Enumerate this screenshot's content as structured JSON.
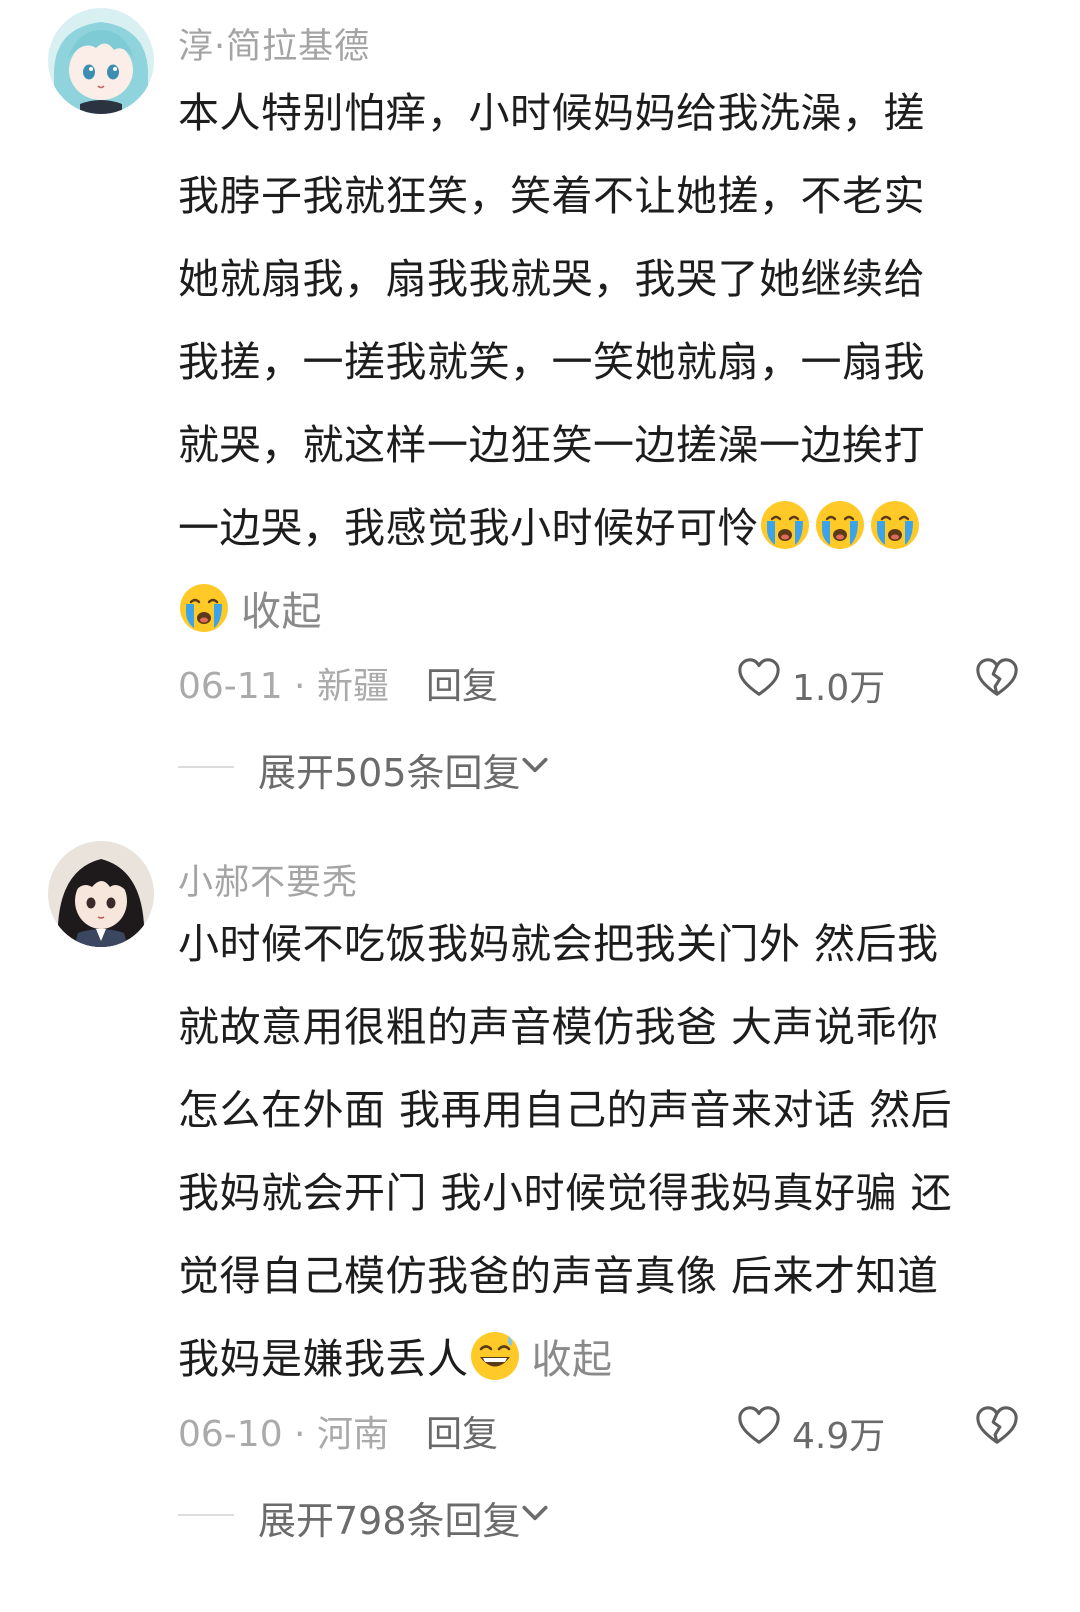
{
  "comments": [
    {
      "username": "淳·简拉基德",
      "lines": [
        "本人特别怕痒，小时候妈妈给我洗澡，搓",
        "我脖子我就狂笑，笑着不让她搓，不老实",
        "她就扇我，扇我我就哭，我哭了她继续给",
        "我搓，一搓我就笑，一笑她就扇，一扇我",
        "就哭，就这样一边狂笑一边搓澡一边挨打",
        "一边哭，我感觉我小时候好可怜"
      ],
      "collapse_label": "收起",
      "emojis": [
        "crying-emoji",
        "crying-emoji",
        "crying-emoji",
        "crying-emoji"
      ],
      "date_location": "06-11 · 新疆",
      "reply_label": "回复",
      "likes": "1.0万",
      "expand_label": "展开505条回复"
    },
    {
      "username": "小郝不要秃",
      "lines": [
        "小时候不吃饭我妈就会把我关门外 然后我",
        "就故意用很粗的声音模仿我爸 大声说乖你",
        "怎么在外面 我再用自己的声音来对话 然后",
        "我妈就会开门 我小时候觉得我妈真好骗 还",
        "觉得自己模仿我爸的声音真像 后来才知道",
        "我妈是嫌我丢人"
      ],
      "collapse_label": "收起",
      "emojis": [
        "grinning-sweat-emoji"
      ],
      "date_location": "06-10 · 河南",
      "reply_label": "回复",
      "likes": "4.9万",
      "expand_label": "展开798条回复"
    }
  ],
  "colors": {
    "background": "#ffffff",
    "body_text": "#1d1d1d",
    "muted_text": "#a4a4a4",
    "emoji_yellow": "#ffc928",
    "emoji_tear": "#3aa3ea"
  }
}
